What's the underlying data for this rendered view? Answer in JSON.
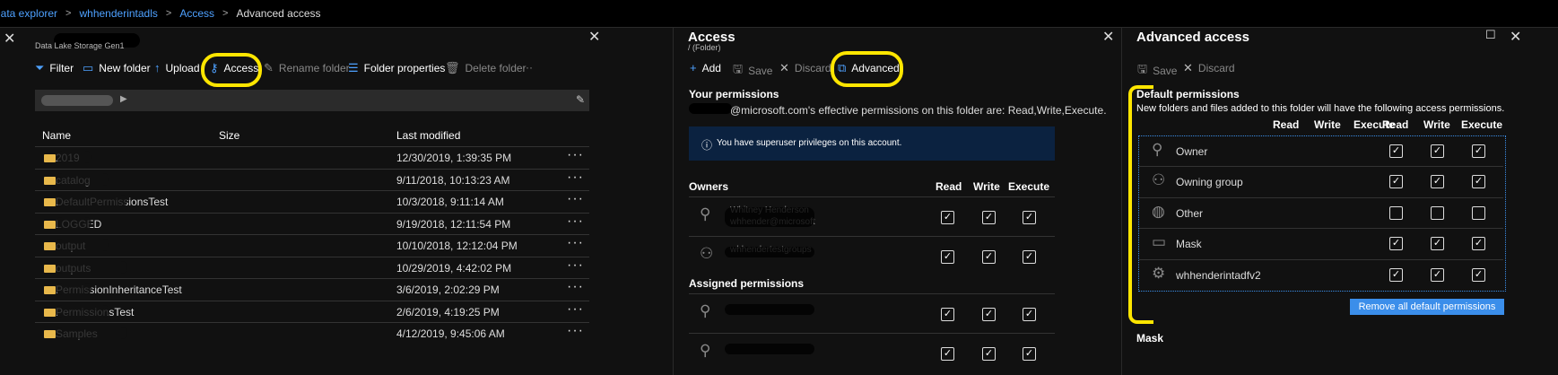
{
  "breadcrumb": [
    "Data explorer",
    "whhenderintadls",
    "Access",
    "Advanced access"
  ],
  "explorer": {
    "subtitle": "Data Lake Storage Gen1",
    "toolbar": {
      "filter": "Filter",
      "new_folder": "New folder",
      "upload": "Upload",
      "access": "Access",
      "rename_folder": "Rename folder",
      "folder_properties": "Folder properties",
      "delete_folder": "Delete folder",
      "more": "···"
    },
    "columns": {
      "name": "Name",
      "size": "Size",
      "last_modified": "Last modified"
    },
    "rows": [
      {
        "name": "2019",
        "modified": "12/30/2019, 1:39:35 PM"
      },
      {
        "name": "catalog",
        "modified": "9/11/2018, 10:13:23 AM"
      },
      {
        "name": "DefaultPermissionsTest",
        "modified": "10/3/2018, 9:11:14 AM"
      },
      {
        "name": "LOGGED",
        "modified": "9/19/2018, 12:11:54 PM"
      },
      {
        "name": "output",
        "modified": "10/10/2018, 12:12:04 PM"
      },
      {
        "name": "outputs",
        "modified": "10/29/2019, 4:42:02 PM"
      },
      {
        "name": "PermissionInheritanceTest",
        "modified": "3/6/2019, 2:02:29 PM"
      },
      {
        "name": "PermissionsTest",
        "modified": "2/6/2019, 4:19:25 PM"
      },
      {
        "name": "Samples",
        "modified": "4/12/2019, 9:45:06 AM"
      }
    ]
  },
  "access": {
    "title": "Access",
    "subtitle": "/ (Folder)",
    "toolbar": {
      "add": "Add",
      "save": "Save",
      "discard": "Discard",
      "advanced": "Advanced"
    },
    "your_permissions_heading": "Your permissions",
    "effective_text": "@microsoft.com's effective permissions on this folder are: Read,Write,Execute.",
    "info_text": "You have superuser privileges on this account.",
    "owners_heading": "Owners",
    "col_read": "Read",
    "col_write": "Write",
    "col_execute": "Execute",
    "owners": [
      {
        "name": "Whitney Henderson",
        "sub": "whhender@microsoft"
      },
      {
        "name": "whhendertestgroups",
        "sub": ""
      }
    ],
    "assigned_heading": "Assigned permissions",
    "assigned": [
      {
        "name": "",
        "sub": ""
      },
      {
        "name": "",
        "sub": ""
      }
    ]
  },
  "advanced": {
    "title": "Advanced access",
    "toolbar": {
      "save": "Save",
      "discard": "Discard"
    },
    "default_heading": "Default permissions",
    "default_desc": "New folders and files added to this folder will have the following access permissions.",
    "col_read": "Read",
    "col_write": "Write",
    "col_execute": "Execute",
    "rows": [
      {
        "name": "Owner",
        "read": true,
        "write": true,
        "execute": true
      },
      {
        "name": "Owning group",
        "read": true,
        "write": true,
        "execute": true
      },
      {
        "name": "Other",
        "read": false,
        "write": false,
        "execute": false
      },
      {
        "name": "Mask",
        "read": true,
        "write": true,
        "execute": true
      },
      {
        "name": "whhenderintadfv2",
        "read": true,
        "write": true,
        "execute": true
      }
    ],
    "remove_button": "Remove all default permissions",
    "mask_heading": "Mask"
  },
  "colors": {
    "accent": "#4ea1ff",
    "highlight": "#ffe600",
    "info_bg": "#0b2240",
    "button": "#3b8eea"
  }
}
